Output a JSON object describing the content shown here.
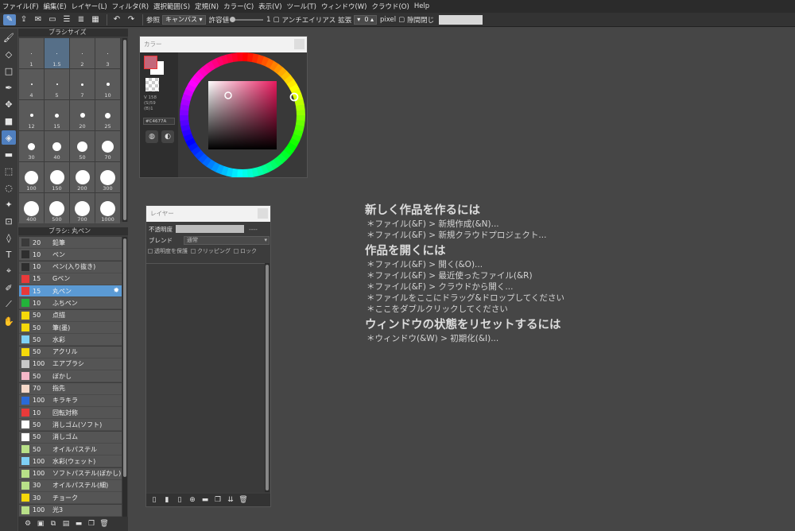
{
  "menu": [
    "ファイル(F)",
    "編集(E)",
    "レイヤー(L)",
    "フィルタ(R)",
    "選択範囲(S)",
    "定規(N)",
    "カラー(C)",
    "表示(V)",
    "ツール(T)",
    "ウィンドウ(W)",
    "クラウド(O)",
    "Help"
  ],
  "toolbar": {
    "ref_label": "参照",
    "ref_value": "キャンバス",
    "tolerance_label": "許容値",
    "tolerance_value": "1",
    "antialias_label": "アンチエイリアス",
    "expand_label": "拡張",
    "expand_value": "0",
    "unit_label": "pixel",
    "gap_close_label": "隙間閉じ"
  },
  "brush_size_panel": {
    "title": "ブラシサイズ",
    "sizes": [
      "1",
      "1.5",
      "2",
      "3",
      "4",
      "5",
      "7",
      "10",
      "12",
      "15",
      "20",
      "25",
      "30",
      "40",
      "50",
      "70",
      "100",
      "150",
      "200",
      "300",
      "400",
      "500",
      "700",
      "1000"
    ],
    "selected": "1.5"
  },
  "brush_list_panel": {
    "title": "ブラシ: 丸ペン",
    "items": [
      {
        "size": "20",
        "name": "鉛筆",
        "color": "#3a3a3a"
      },
      {
        "size": "10",
        "name": "ペン",
        "color": "#2e2e2e"
      },
      {
        "size": "10",
        "name": "ペン(入り抜き)",
        "color": "#2e2e2e"
      },
      {
        "size": "15",
        "name": "Gペン",
        "color": "#e83a3a"
      },
      {
        "size": "15",
        "name": "丸ペン",
        "color": "#e83a3a",
        "selected": true
      },
      {
        "size": "10",
        "name": "ふちペン",
        "color": "#22b33a"
      },
      {
        "size": "50",
        "name": "点描",
        "color": "#f5d90a"
      },
      {
        "size": "50",
        "name": "筆(墨)",
        "color": "#f5d90a"
      },
      {
        "size": "50",
        "name": "水彩",
        "color": "#7ed0f5"
      },
      {
        "size": "50",
        "name": "アクリル",
        "color": "#f5d90a"
      },
      {
        "size": "100",
        "name": "エアブラシ",
        "color": "#c8c8c8"
      },
      {
        "size": "50",
        "name": "ぼかし",
        "color": "#f5b8c8"
      },
      {
        "size": "70",
        "name": "指先",
        "color": "#f5d8c8"
      },
      {
        "size": "100",
        "name": "キラキラ",
        "color": "#2a6ad8"
      },
      {
        "size": "10",
        "name": "回転対称",
        "color": "#e83a3a"
      },
      {
        "size": "50",
        "name": "消しゴム(ソフト)",
        "color": "#ffffff"
      },
      {
        "size": "50",
        "name": "消しゴム",
        "color": "#ffffff"
      },
      {
        "size": "50",
        "name": "オイルパステル",
        "color": "#b8e088"
      },
      {
        "size": "100",
        "name": "水彩(ウェット)",
        "color": "#7ed0f5"
      },
      {
        "size": "100",
        "name": "ソフトパステル(ぼかし)",
        "color": "#b8e088"
      },
      {
        "size": "30",
        "name": "オイルパステル(細)",
        "color": "#b8e088"
      },
      {
        "size": "30",
        "name": "チョーク",
        "color": "#f5d90a"
      },
      {
        "size": "100",
        "name": "光3",
        "color": "#b8e088"
      }
    ]
  },
  "color_window": {
    "title": "カラー",
    "fg_color": "#c4677a",
    "hsv_text": [
      "V 158",
      "(S)59",
      "(B)1"
    ],
    "hex_value": "#C4677A"
  },
  "layer_window": {
    "title": "レイヤー",
    "opacity_label": "不透明度",
    "opacity_value": "----",
    "blend_label": "ブレンド",
    "blend_value": "通常",
    "protect_alpha_label": "透明度を保護",
    "clipping_label": "クリッピング",
    "lock_label": "ロック"
  },
  "welcome": {
    "new_heading": "新しく作品を作るには",
    "new_lines": [
      "＊ファイル(&F) > 新規作成(&N)...",
      "＊ファイル(&F) > 新規クラウドプロジェクト..."
    ],
    "open_heading": "作品を開くには",
    "open_lines": [
      "＊ファイル(&F) > 開く(&O)...",
      "＊ファイル(&F) > 最近使ったファイル(&R)",
      "＊ファイル(&F) > クラウドから開く...",
      "＊ファイルをここにドラッグ&ドロップしてください",
      "＊ここをダブルクリックしてください"
    ],
    "reset_heading": "ウィンドウの状態をリセットするには",
    "reset_lines": [
      "＊ウィンドウ(&W) > 初期化(&I)..."
    ]
  },
  "colors": {
    "accent": "#5b9ad4",
    "background": "#464646",
    "panel": "#3d3d3d"
  }
}
